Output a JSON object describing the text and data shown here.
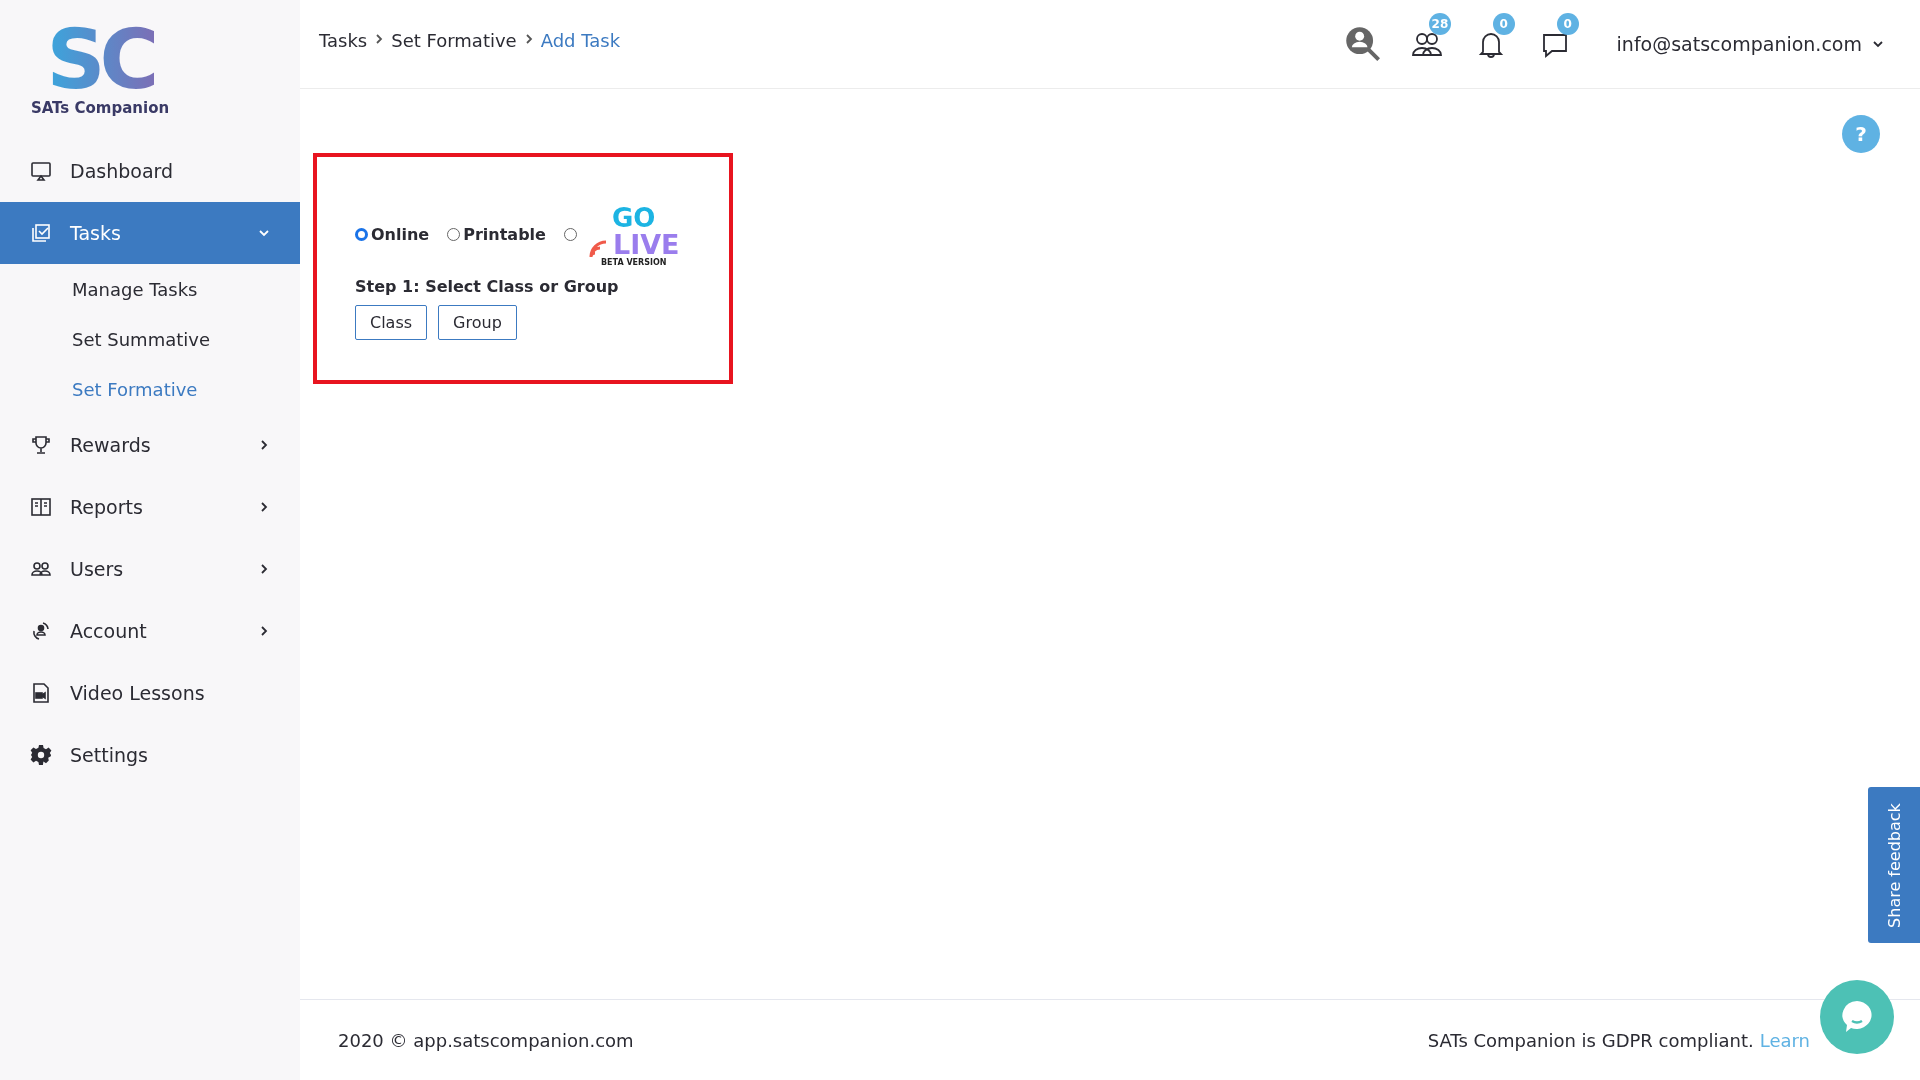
{
  "logo": {
    "mark": "SC",
    "name": "SATs Companion"
  },
  "sidebar": {
    "items": [
      {
        "kind": "dashboard",
        "label": "Dashboard",
        "selected": false
      },
      {
        "kind": "tasks",
        "label": "Tasks",
        "selected": true,
        "expanded": true,
        "children": [
          {
            "label": "Manage Tasks",
            "selected": false
          },
          {
            "label": "Set Summative",
            "selected": false
          },
          {
            "label": "Set Formative",
            "selected": true
          }
        ]
      },
      {
        "kind": "rewards",
        "label": "Rewards",
        "selected": false,
        "expanded": false
      },
      {
        "kind": "reports",
        "label": "Reports",
        "selected": false,
        "expanded": false
      },
      {
        "kind": "users",
        "label": "Users",
        "selected": false,
        "expanded": false
      },
      {
        "kind": "account",
        "label": "Account",
        "selected": false,
        "expanded": false
      },
      {
        "kind": "video",
        "label": "Video Lessons",
        "selected": false
      },
      {
        "kind": "settings",
        "label": "Settings",
        "selected": false
      }
    ]
  },
  "breadcrumb": [
    {
      "label": "Tasks"
    },
    {
      "label": "Set Formative"
    },
    {
      "label": "Add Task"
    }
  ],
  "header": {
    "icons": [
      {
        "kind": "search"
      },
      {
        "kind": "users",
        "badge": "28"
      },
      {
        "kind": "bell",
        "badge": "0"
      },
      {
        "kind": "chat",
        "badge": "0"
      }
    ],
    "user": "info@satscompanion.com"
  },
  "form": {
    "modes": [
      {
        "kind": "text",
        "label": "Online",
        "selected": true
      },
      {
        "kind": "text",
        "label": "Printable",
        "selected": false
      },
      {
        "kind": "golive",
        "go": "GO",
        "live": "LIVE",
        "beta": "BETA VERSION",
        "selected": false
      }
    ],
    "step": "Step 1: Select Class or Group",
    "buttons": [
      "Class",
      "Group"
    ]
  },
  "help": "?",
  "feedback": "Share feedback",
  "footer": {
    "copyright": "2020 © app.satscompanion.com",
    "notice": "SATs Companion is GDPR compliant.",
    "link": "Learn"
  }
}
